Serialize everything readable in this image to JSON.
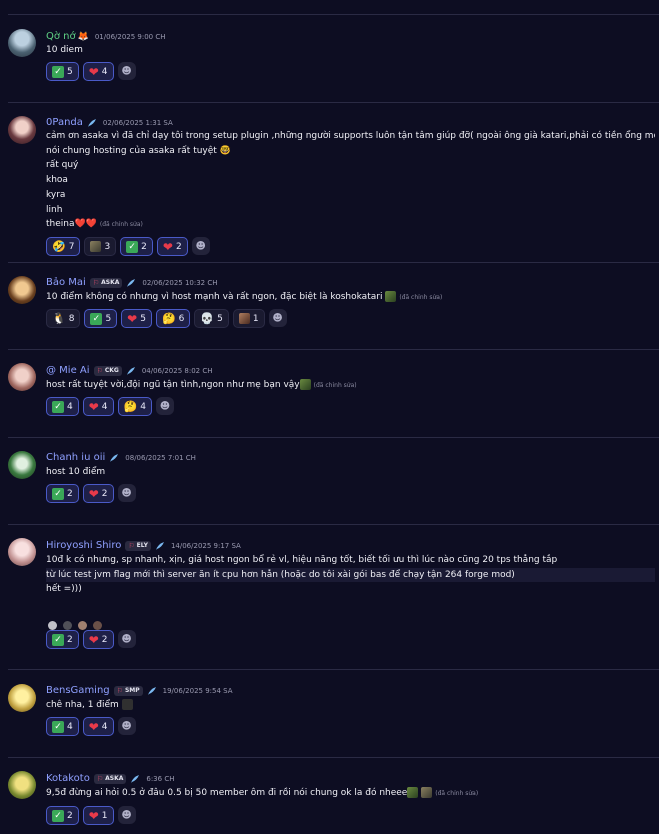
{
  "messages": [
    {
      "author": "Qờ nớ",
      "timestamp": "01/06/2025 9:00 CH",
      "lines": [
        "10 diem"
      ],
      "reactions": [
        {
          "emoji": "check-emoji",
          "count": "5"
        },
        {
          "emoji": "heart-emoji",
          "count": "4"
        }
      ]
    },
    {
      "author": "0Panda",
      "timestamp": "02/06/2025 1:31 SA",
      "lines": [
        "cảm ơn asaka vì đã chỉ dạy tôi trong setup plugin ,những người supports luôn tận tâm giúp đỡ( ngoài ông già katari,phải có tiền ổng mới làm) .",
        "nói chung hosting của asaka rất tuyệt 🤓",
        "rất quý",
        "khoa",
        "kyra",
        "linh",
        "theina❤️❤️"
      ],
      "edited": "(đã chỉnh sửa)",
      "reactions": [
        {
          "emoji": "rofl-emoji",
          "count": "7"
        },
        {
          "emoji": "custom-image-emoji",
          "count": "3"
        },
        {
          "emoji": "check-emoji",
          "count": "2"
        },
        {
          "emoji": "heart-emoji",
          "count": "2"
        }
      ]
    },
    {
      "author": "Bảo Mai",
      "tag": "ASKA",
      "timestamp": "02/06/2025 10:32 CH",
      "lines": [
        "10 điểm không có nhưng vì host mạnh và rất ngon, đặc biệt là koshokatari"
      ],
      "edited": "(đã chỉnh sửa)",
      "reactions": [
        {
          "emoji": "penguin-emoji",
          "count": "8"
        },
        {
          "emoji": "check-emoji",
          "count": "5"
        },
        {
          "emoji": "heart-emoji",
          "count": "5"
        },
        {
          "emoji": "thinking-emoji",
          "count": "6"
        },
        {
          "emoji": "skull-emoji",
          "count": "5"
        },
        {
          "emoji": "custom-image-emoji",
          "count": "1"
        }
      ]
    },
    {
      "author": "@ Mie Ai",
      "tag": "CKG",
      "timestamp": "04/06/2025 8:02 CH",
      "lines": [
        "host rất tuyệt vời,đội ngũ tận tình,ngon như mẹ bạn vậy"
      ],
      "edited": "(đã chỉnh sửa)",
      "reactions": [
        {
          "emoji": "check-emoji",
          "count": "4"
        },
        {
          "emoji": "heart-emoji",
          "count": "4"
        },
        {
          "emoji": "thinking-emoji",
          "count": "4"
        }
      ]
    },
    {
      "author": "Chanh iu oii",
      "timestamp": "08/06/2025 7:01 CH",
      "lines": [
        "host 10 điểm"
      ],
      "reactions": [
        {
          "emoji": "check-emoji",
          "count": "2"
        },
        {
          "emoji": "heart-emoji",
          "count": "2"
        }
      ]
    },
    {
      "author": "Hiroyoshi Shiro",
      "tag": "ELY",
      "timestamp": "14/06/2025 9:17 SA",
      "lines": [
        "10đ k có nhưng, sp nhanh, xịn, giá host ngon bổ rẻ vl, hiệu năng tốt, biết tối ưu thì lúc nào cũng 20 tps thẳng tắp",
        "",
        "từ lúc test jvm flag mới thì server ăn ít cpu hơn hẳn (hoặc do tôi xài gói bas để chạy tận 264 forge mod)",
        "hết =)))"
      ],
      "reactions": [
        {
          "emoji": "check-emoji",
          "count": "2"
        },
        {
          "emoji": "heart-emoji",
          "count": "2"
        }
      ]
    },
    {
      "author": "BensGaming",
      "tag": "SMP",
      "timestamp": "19/06/2025 9:54 SA",
      "lines": [
        "chê nha, 1 điểm"
      ],
      "reactions": [
        {
          "emoji": "check-emoji",
          "count": "4"
        },
        {
          "emoji": "heart-emoji",
          "count": "4"
        }
      ]
    },
    {
      "author": "Kotakoto",
      "tag": "ASKA",
      "timestamp": "6:36 CH",
      "lines": [
        "9,5đ đừng ai hỏi 0.5 ở đâu 0.5 bị 50 member ôm đi rồi nói chung ok la đó nheee"
      ],
      "edited": "(đã chỉnh sửa)",
      "reactions": [
        {
          "emoji": "check-emoji",
          "count": "2"
        },
        {
          "emoji": "heart-emoji",
          "count": "1"
        }
      ]
    }
  ],
  "colors": {
    "background": "#0d0d22",
    "accent": "#4a5ac8",
    "author": "#8fa0ff"
  }
}
